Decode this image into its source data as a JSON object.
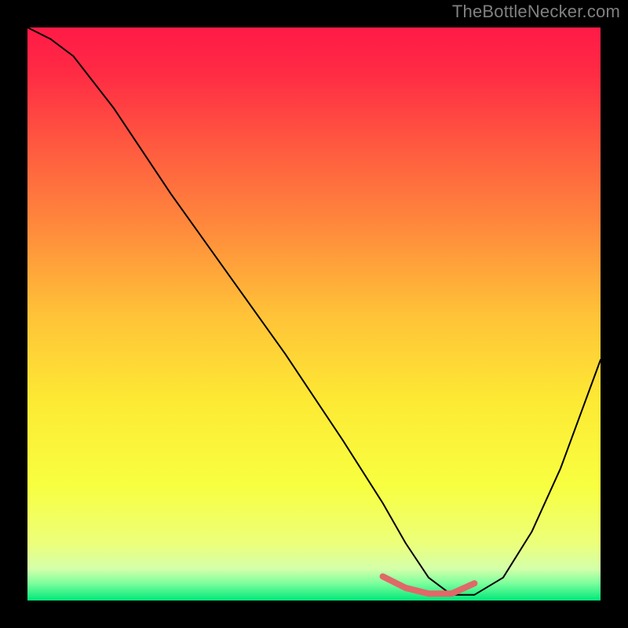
{
  "attribution": "TheBottleNecker.com",
  "chart_data": {
    "type": "line",
    "title": "",
    "xlabel": "",
    "ylabel": "",
    "xlim": [
      0,
      100
    ],
    "ylim": [
      0,
      100
    ],
    "background_gradient": {
      "stops": [
        {
          "offset": 0.0,
          "color": "#ff1a47"
        },
        {
          "offset": 0.08,
          "color": "#ff2b44"
        },
        {
          "offset": 0.2,
          "color": "#ff5740"
        },
        {
          "offset": 0.35,
          "color": "#ff8a3c"
        },
        {
          "offset": 0.5,
          "color": "#ffc238"
        },
        {
          "offset": 0.65,
          "color": "#fde934"
        },
        {
          "offset": 0.8,
          "color": "#f8ff40"
        },
        {
          "offset": 0.9,
          "color": "#ecff7a"
        },
        {
          "offset": 0.945,
          "color": "#d4ffaa"
        },
        {
          "offset": 0.97,
          "color": "#7cff9c"
        },
        {
          "offset": 1.0,
          "color": "#00e87a"
        }
      ]
    },
    "series": [
      {
        "name": "bottleneck-curve",
        "color": "#000000",
        "stroke_width": 2,
        "x": [
          0,
          4,
          8,
          15,
          25,
          35,
          45,
          55,
          62,
          66,
          70,
          74,
          78,
          83,
          88,
          93,
          100
        ],
        "values": [
          100,
          98,
          95,
          86,
          71,
          57,
          43,
          28,
          17,
          10,
          4,
          1,
          1,
          4,
          12,
          23,
          42
        ]
      },
      {
        "name": "highlight-band",
        "color": "#e06868",
        "stroke_width": 8,
        "x": [
          62,
          66,
          70,
          74,
          78
        ],
        "values": [
          4.2,
          2.2,
          1.2,
          1.2,
          3.0
        ]
      }
    ]
  }
}
